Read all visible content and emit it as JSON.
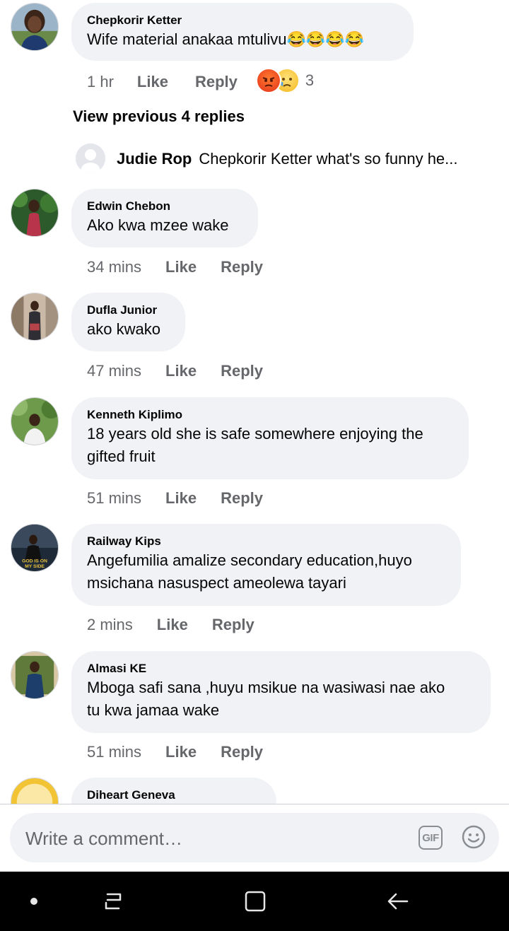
{
  "colors": {
    "bubble_bg": "#f0f2f5",
    "meta_text": "#65676b",
    "nav_bg": "#000000"
  },
  "top_comment": {
    "author": "Chepkorir Ketter",
    "text": "Wife material anakaa mtulivu",
    "emoji_suffix": [
      "laughing-tears-emoji",
      "laughing-tears-emoji",
      "laughing-tears-emoji",
      "laughing-tears-emoji"
    ],
    "time": "1 hr",
    "like_label": "Like",
    "reply_label": "Reply",
    "reactions": [
      "angry-reaction",
      "sad-reaction"
    ],
    "reaction_count": "3"
  },
  "view_previous": "View previous 4 replies",
  "latest_reply": {
    "author": "Judie Rop",
    "text": "Chepkorir Ketter what's so funny he..."
  },
  "comments": [
    {
      "author": "Edwin Chebon",
      "lines": [
        "Ako kwa mzee wake"
      ],
      "time": "34 mins",
      "like_label": "Like",
      "reply_label": "Reply"
    },
    {
      "author": "Dufla Junior",
      "lines": [
        "ako kwako"
      ],
      "time": "47 mins",
      "like_label": "Like",
      "reply_label": "Reply"
    },
    {
      "author": "Kenneth Kiplimo",
      "lines": [
        "18 years old she is safe somewhere enjoying the",
        "gifted fruit"
      ],
      "time": "51 mins",
      "like_label": "Like",
      "reply_label": "Reply"
    },
    {
      "author": "Railway Kips",
      "lines": [
        "Angefumilia amalize secondary education,huyo",
        "msichana nasuspect ameolewa tayari"
      ],
      "time": "2 mins",
      "like_label": "Like",
      "reply_label": "Reply",
      "avatar_text": [
        "GOD IS ON",
        "MY SIDE"
      ]
    },
    {
      "author": "Almasi KE",
      "lines": [
        "Mboga safi sana ,huyu msikue na wasiwasi nae ako",
        "tu kwa jamaa wake"
      ],
      "time": "51 mins",
      "like_label": "Like",
      "reply_label": "Reply"
    },
    {
      "author": "Diheart Geneva"
    }
  ],
  "composer": {
    "placeholder": "Write a comment…",
    "gif_label": "GIF",
    "emoji_icon": "smiley-icon"
  },
  "navbar": {
    "icons": [
      "dot-icon",
      "recent-apps-icon",
      "home-icon",
      "back-icon"
    ]
  }
}
